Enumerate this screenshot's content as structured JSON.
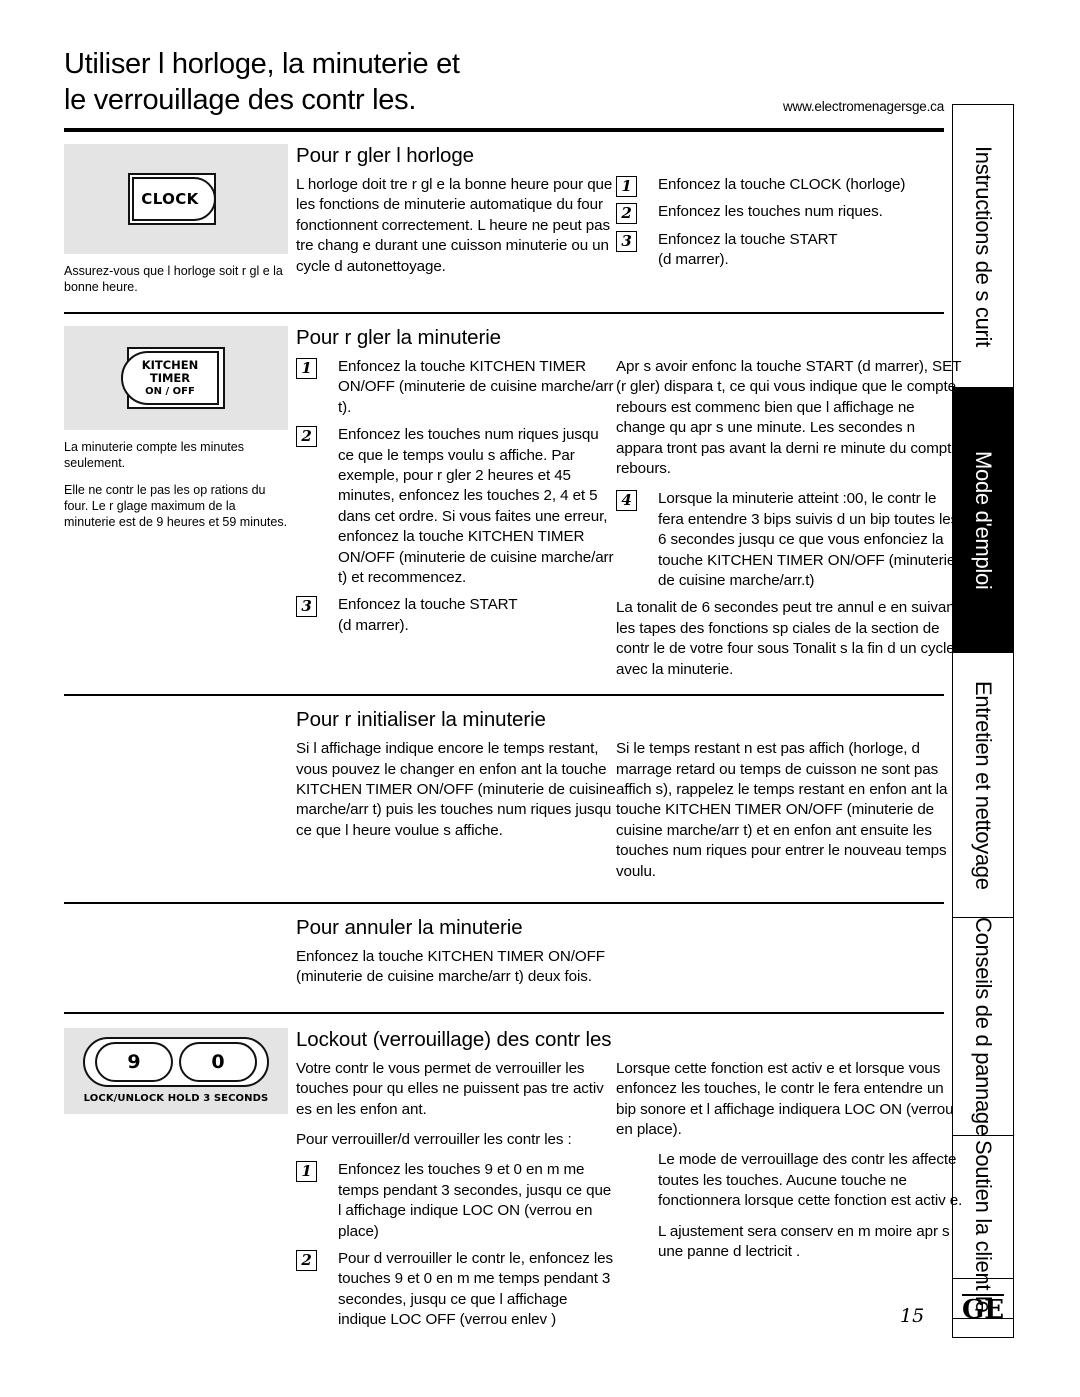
{
  "header": {
    "title": "Utiliser l horloge, la minuterie et\nle verrouillage des contr les.",
    "website": "www.electromenagersge.ca"
  },
  "sections": {
    "clock": {
      "heading": "Pour r gler l horloge",
      "button_label": "CLOCK",
      "caption": "Assurez-vous que l horloge soit r gl e  la bonne heure.",
      "body": "L horloge doit  tre r gl e  la bonne heure pour que les fonctions de minuterie automatique du four fonctionnent correctement. L heure ne peut pas  tre chang e durant une cuisson  minuterie ou un cycle d autonettoyage.",
      "steps": [
        "Enfoncez la touche CLOCK (horloge)",
        "Enfoncez les touches num riques.",
        "Enfoncez la touche START\n(d marrer)."
      ]
    },
    "timer_set": {
      "heading": "Pour r gler la minuterie",
      "button_line1": "KITCHEN",
      "button_line2": "TIMER",
      "button_line3": "ON / OFF",
      "caption_1": "La minuterie compte les minutes seulement.",
      "caption_2": "Elle ne contr le pas les op rations du four. Le r glage maximum de la minuterie est de 9 heures et 59 minutes.",
      "steps": [
        "Enfoncez la touche KITCHEN TIMER ON/OFF (minuterie de cuisine marche/arr t).",
        "Enfoncez les touches num riques jusqu  ce que le temps voulu s affiche. Par exemple, pour r gler 2 heures et 45 minutes, enfoncez les touches 2, 4 et 5 dans cet ordre. Si vous faites une erreur, enfoncez la touche KITCHEN TIMER ON/OFF (minuterie de cuisine marche/arr t) et recommencez.",
        "Enfoncez la touche START\n(d marrer)."
      ],
      "note_1": "Apr s avoir enfonc  la touche START (d marrer), SET (r gler) dispara t, ce qui vous indique que le compte  rebours est commenc  bien que l affichage ne change qu apr s une minute. Les secondes n appara tront pas avant la derni re minute du compte  rebours.",
      "step_4": "Lorsque la minuterie atteint  :00, le contr le fera entendre 3 bips suivis d un bip toutes les 6 secondes jusqu  ce que vous enfonciez la touche KITCHEN TIMER ON/OFF (minuterie de cuisine marche/arr.t)",
      "note_2": "La tonalit  de 6 secondes peut  tre annul e en suivant les  tapes des fonctions sp ciales de la section de contr le de votre four sous Tonalit s  la fin d un cycle avec la minuterie."
    },
    "timer_reset": {
      "heading": "Pour r initialiser la minuterie",
      "left": "Si l affichage indique encore le temps restant, vous pouvez le changer en enfon ant la touche  KITCHEN TIMER ON/OFF (minuterie de cuisine marche/arr t) puis les touches num riques jusqu  ce que l heure voulue s affiche.",
      "right": "Si le temps restant n est pas affich  (horloge, d marrage retard  ou temps de cuisson ne sont pas affich s), rappelez le temps restant en enfon ant la touche KITCHEN TIMER ON/OFF (minuterie de cuisine marche/arr t) et en enfon ant ensuite les touches num riques pour entrer le nouveau temps voulu."
    },
    "timer_cancel": {
      "heading": "Pour annuler la minuterie",
      "body": "Enfoncez la touche KITCHEN TIMER ON/OFF (minuterie de cuisine marche/arr t) deux fois."
    },
    "lockout": {
      "heading": "Lockout (verrouillage) des contr les",
      "key_9": "9",
      "key_0": "0",
      "key_caption": "LOCK/UNLOCK HOLD 3 SECONDS",
      "intro": "Votre contr le vous permet de verrouiller les touches pour qu elles ne puissent pas  tre activ es en les enfon ant.",
      "howto_label": "Pour verrouiller/d verrouiller les contr les :",
      "steps": [
        "Enfoncez les touches 9 et 0 en m me temps pendant 3 secondes, jusqu  ce que l affichage indique LOC ON (verrou en place)",
        "Pour d verrouiller le contr le, enfoncez les touches 9 et 0 en m me temps pendant 3 secondes, jusqu  ce que l affichage indique LOC OFF (verrou enlev )"
      ],
      "right_1": "Lorsque cette fonction est activ e et lorsque vous enfoncez les touches, le contr le fera entendre un bip sonore et l affichage indiquera LOC ON (verrou en place).",
      "right_2": "Le mode de verrouillage des contr les affecte toutes les touches. Aucune touche ne fonctionnera lorsque cette fonction est activ e.",
      "right_3": "L ajustement sera conserv  en m moire apr s une panne d  lectricit ."
    }
  },
  "sidebar": {
    "tabs": [
      {
        "label": "Instructions de s curit ",
        "dark": false
      },
      {
        "label": "Mode d'emploi",
        "dark": true
      },
      {
        "label": "Entretien et nettoyage",
        "dark": false
      },
      {
        "label": "Conseils de d pannage",
        "dark": false
      },
      {
        "label": "Soutien  la client le",
        "dark": false
      }
    ]
  },
  "footer": {
    "page_number": "15",
    "logo": "GE"
  }
}
